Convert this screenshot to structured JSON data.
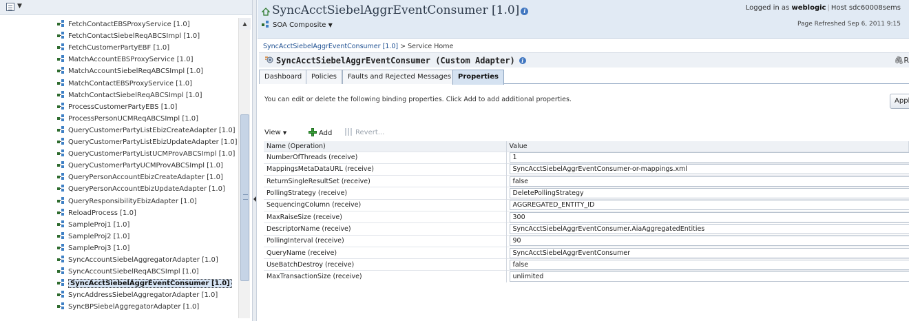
{
  "tree": {
    "items": [
      "FetchContactEBSProxyService [1.0]",
      "FetchContactSiebelReqABCSImpl [1.0]",
      "FetchCustomerPartyEBF [1.0]",
      "MatchAccountEBSProxyService [1.0]",
      "MatchAccountSiebelReqABCSImpl [1.0]",
      "MatchContactEBSProxyService [1.0]",
      "MatchContactSiebelReqABCSImpl [1.0]",
      "ProcessCustomerPartyEBS [1.0]",
      "ProcessPersonUCMReqABCSImpl [1.0]",
      "QueryCustomerPartyListEbizCreateAdapter [1.0]",
      "QueryCustomerPartyListEbizUpdateAdapter [1.0]",
      "QueryCustomerPartyListUCMProvABCSImpl [1.0]",
      "QueryCustomerPartyUCMProvABCSImpl [1.0]",
      "QueryPersonAccountEbizCreateAdapter [1.0]",
      "QueryPersonAccountEbizUpdateAdapter [1.0]",
      "QueryResponsibilityEbizAdapter [1.0]",
      "ReloadProcess [1.0]",
      "SampleProj1 [1.0]",
      "SampleProj2 [1.0]",
      "SampleProj3 [1.0]",
      "SyncAccountSiebelAggregatorAdapter [1.0]",
      "SyncAccountSiebelReqABCSImpl [1.0]",
      "SyncAcctSiebelAggrEventConsumer [1.0]",
      "SyncAddressSiebelAggregatorAdapter [1.0]",
      "SyncBPSiebelAggregatorAdapter [1.0]"
    ],
    "selected_index": 22
  },
  "header": {
    "title": "SyncAcctSiebelAggrEventConsumer [1.0]",
    "soa_menu": "SOA Composite",
    "logged_in_prefix": "Logged in as",
    "user": "weblogic",
    "host_prefix": "Host",
    "host": "sdc60008sems",
    "page_refreshed": "Page Refreshed Sep 6, 2011 9:15"
  },
  "breadcrumb": {
    "link": "SyncAcctSiebelAggrEventConsumer [1.0]",
    "separator": ">",
    "current": "Service Home"
  },
  "service": {
    "title": "SyncAcctSiebelAggrEventConsumer (Custom Adapter)",
    "clip_text": "R"
  },
  "tabs": [
    "Dashboard",
    "Policies",
    "Faults and Rejected Messages",
    "Properties"
  ],
  "active_tab": "Properties",
  "properties": {
    "description": "You can edit or delete the following binding properties. Click Add to add additional properties.",
    "apply_label": "Apply",
    "toolbar": {
      "view": "View",
      "add": "Add",
      "revert": "Revert..."
    },
    "columns": [
      "Name (Operation)",
      "Value"
    ],
    "rows": [
      {
        "name": "NumberOfThreads (receive)",
        "value": "1"
      },
      {
        "name": "MappingsMetaDataURL (receive)",
        "value": "SyncAcctSiebelAggrEventConsumer-or-mappings.xml"
      },
      {
        "name": "ReturnSingleResultSet (receive)",
        "value": "false"
      },
      {
        "name": "PollingStrategy (receive)",
        "value": "DeletePollingStrategy"
      },
      {
        "name": "SequencingColumn (receive)",
        "value": "AGGREGATED_ENTITY_ID"
      },
      {
        "name": "MaxRaiseSize (receive)",
        "value": "300"
      },
      {
        "name": "DescriptorName (receive)",
        "value": "SyncAcctSiebelAggrEventConsumer.AiaAggregatedEntities"
      },
      {
        "name": "PollingInterval (receive)",
        "value": "90"
      },
      {
        "name": "QueryName (receive)",
        "value": "SyncAcctSiebelAggrEventConsumer"
      },
      {
        "name": "UseBatchDestroy (receive)",
        "value": "false"
      },
      {
        "name": "MaxTransactionSize (receive)",
        "value": "unlimited"
      }
    ]
  },
  "colors": {
    "header_bg": "#e1eaf4",
    "active_tab_bg": "#d5e2f1",
    "link": "#1d4f91",
    "add_icon": "#3aa23a"
  }
}
